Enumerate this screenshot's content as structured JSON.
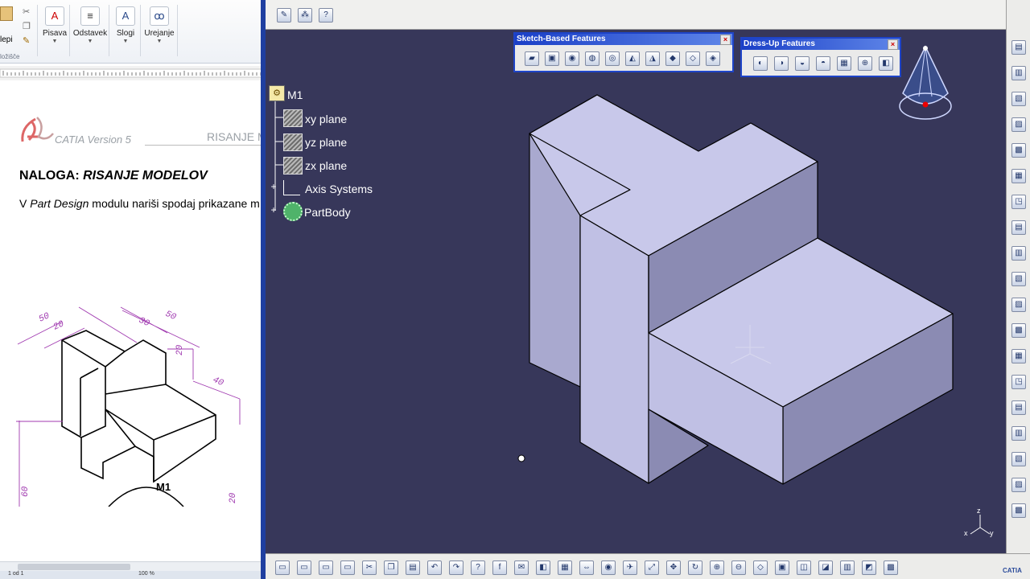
{
  "word": {
    "ribbon": {
      "paste_label": "lepi",
      "clipboard_group": "ložišče",
      "buttons": [
        {
          "label": "Pisava",
          "icon": "font-color-icon"
        },
        {
          "label": "Odstavek",
          "icon": "paragraph-icon"
        },
        {
          "label": "Slogi",
          "icon": "styles-icon"
        },
        {
          "label": "Urejanje",
          "icon": "find-binoculars-icon"
        }
      ]
    },
    "doc": {
      "logo_text": "CATIA Version 5",
      "header_right": "RISANJE M",
      "heading_prefix": "NALOGA: ",
      "heading_em": "RISANJE MODELOV",
      "intro_v": "V ",
      "intro_em": "Part Design",
      "intro_rest": " modulu nariši spodaj prikazane m"
    },
    "drawing": {
      "label": "M1",
      "dims": [
        "50",
        "30",
        "50",
        "20",
        "20",
        "40",
        "60",
        "20"
      ]
    },
    "status": {
      "page": "1 od 1",
      "zoom": "100 %"
    }
  },
  "catia": {
    "sketch_toolbar": {
      "title": "Sketch-Based Features",
      "close": "×"
    },
    "dressup_toolbar": {
      "title": "Dress-Up Features",
      "close": "×"
    },
    "tree": {
      "root": "M1",
      "items": [
        "xy plane",
        "yz plane",
        "zx plane",
        "Axis Systems",
        "PartBody"
      ]
    },
    "compass": {
      "x": "x",
      "y": "y",
      "z": "z"
    },
    "brand": "CATIA",
    "colors": {
      "background": "#37375a",
      "face_top": "#c8c8ea",
      "face_side": "#a9a9cf",
      "face_dark": "#8b8bb3",
      "toolbar_title": "#1a3fc7"
    }
  }
}
